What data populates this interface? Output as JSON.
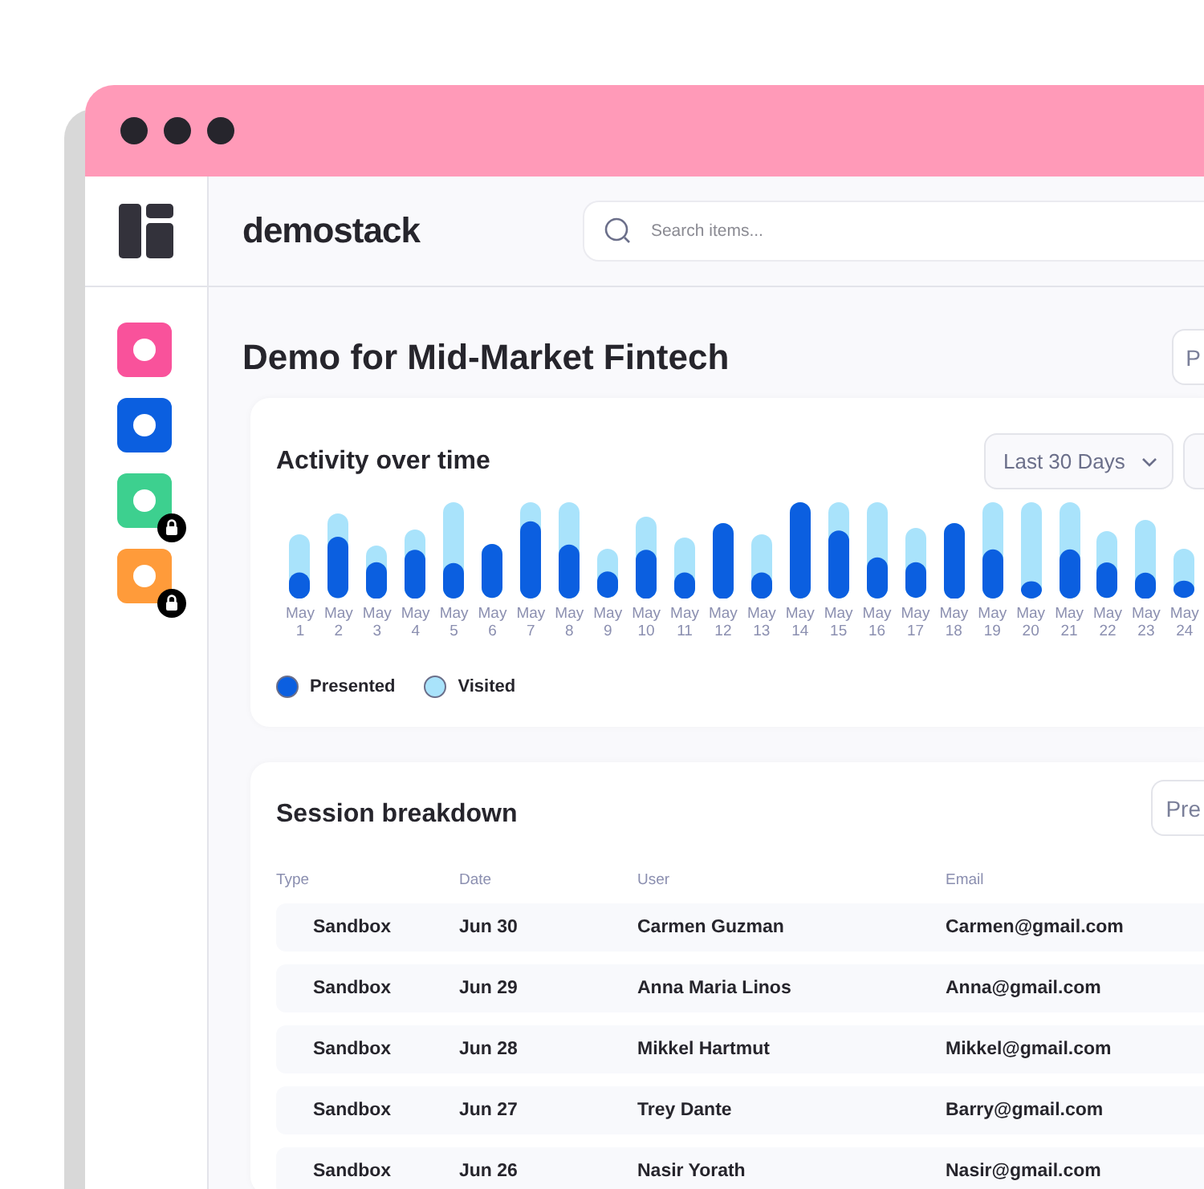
{
  "sidebar": {
    "items": [
      {
        "color": "#f9529b",
        "locked": false
      },
      {
        "color": "#0b5fe0",
        "locked": false
      },
      {
        "color": "#3dd08f",
        "locked": true
      },
      {
        "color": "#ff9b3a",
        "locked": true
      }
    ]
  },
  "header": {
    "brand": "demostack",
    "search": {
      "placeholder": "Search items..."
    }
  },
  "page": {
    "title": "Demo for Mid-Market Fintech",
    "button": "P"
  },
  "activity": {
    "title": "Activity over time",
    "range": "Last 30 Days",
    "x_labels": [
      [
        "May",
        "1"
      ],
      [
        "May",
        "2"
      ],
      [
        "May",
        "3"
      ],
      [
        "May",
        "4"
      ],
      [
        "May",
        "5"
      ],
      [
        "May",
        "6"
      ],
      [
        "May",
        "7"
      ],
      [
        "May",
        "8"
      ],
      [
        "May",
        "9"
      ],
      [
        "May",
        "10"
      ],
      [
        "May",
        "11"
      ],
      [
        "May",
        "12"
      ],
      [
        "May",
        "13"
      ],
      [
        "May",
        "14"
      ],
      [
        "May",
        "15"
      ],
      [
        "May",
        "16"
      ],
      [
        "May",
        "17"
      ],
      [
        "May",
        "18"
      ],
      [
        "May",
        "19"
      ],
      [
        "May",
        "20"
      ],
      [
        "May",
        "21"
      ],
      [
        "May",
        "22"
      ],
      [
        "May",
        "23"
      ],
      [
        "May",
        "24"
      ]
    ],
    "legend": [
      {
        "label": "Presented",
        "color": "#0b5fe0"
      },
      {
        "label": "Visited",
        "color": "#a9e3fb"
      }
    ]
  },
  "sessions": {
    "title": "Session breakdown",
    "button": "Pre",
    "columns": [
      "Type",
      "Date",
      "User",
      "Email"
    ],
    "rows": [
      [
        "Sandbox",
        "Jun 30",
        "Carmen Guzman",
        "Carmen@gmail.com"
      ],
      [
        "Sandbox",
        "Jun 29",
        "Anna Maria Linos",
        "Anna@gmail.com"
      ],
      [
        "Sandbox",
        "Jun 28",
        "Mikkel Hartmut",
        "Mikkel@gmail.com"
      ],
      [
        "Sandbox",
        "Jun 27",
        "Trey Dante",
        "Barry@gmail.com"
      ],
      [
        "Sandbox",
        "Jun 26",
        "Nasir Yorath",
        "Nasir@gmail.com"
      ]
    ]
  }
}
